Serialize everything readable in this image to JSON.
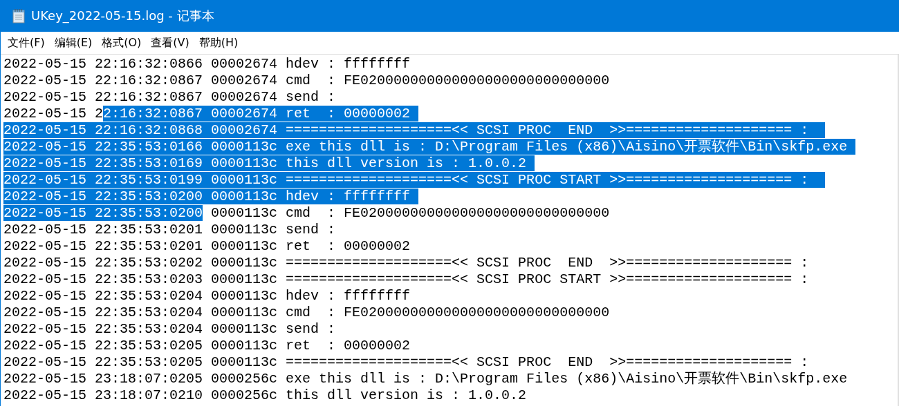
{
  "window": {
    "title": "UKey_2022-05-15.log - 记事本"
  },
  "menu": [
    {
      "label": "文件(F)"
    },
    {
      "label": "编辑(E)"
    },
    {
      "label": "格式(O)"
    },
    {
      "label": "查看(V)"
    },
    {
      "label": "帮助(H)"
    }
  ],
  "lines": [
    {
      "segments": [
        {
          "text": "2022-05-15 22:16:32:0866 00002674 hdev : ffffffff",
          "selected": false
        }
      ]
    },
    {
      "segments": [
        {
          "text": "2022-05-15 22:16:32:0867 00002674 cmd  : FE020000000000000000000000000000",
          "selected": false
        }
      ]
    },
    {
      "segments": [
        {
          "text": "2022-05-15 22:16:32:0867 00002674 send :",
          "selected": false
        }
      ]
    },
    {
      "segments": [
        {
          "text": "2022-05-15 2",
          "selected": false
        },
        {
          "text": "2:16:32:0867 00002674 ret  : 00000002",
          "selected": true
        }
      ]
    },
    {
      "segments": [
        {
          "text": "2022-05-15 22:16:32:0868 00002674 ====================<< SCSI PROC  END  >>==================== : ",
          "selected": true
        }
      ]
    },
    {
      "segments": [
        {
          "text": "2022-05-15 22:35:53:0166 0000113c exe this dll is : D:\\Program Files (x86)\\Aisino\\开票软件\\Bin\\skfp.exe",
          "selected": true
        }
      ]
    },
    {
      "segments": [
        {
          "text": "2022-05-15 22:35:53:0169 0000113c this dll version is : 1.0.0.2",
          "selected": true
        }
      ]
    },
    {
      "segments": [
        {
          "text": "2022-05-15 22:35:53:0199 0000113c ====================<< SCSI PROC START >>==================== : ",
          "selected": true
        }
      ]
    },
    {
      "segments": [
        {
          "text": "2022-05-15 22:35:53:0200 0000113c hdev : ffffffff",
          "selected": true
        }
      ]
    },
    {
      "segments": [
        {
          "text": "2022-05-15 22:35:53:0200",
          "selected": true
        },
        {
          "text": " 0000113c cmd  : FE020000000000000000000000000000",
          "selected": false
        }
      ]
    },
    {
      "segments": [
        {
          "text": "2022-05-15 22:35:53:0201 0000113c send :",
          "selected": false
        }
      ]
    },
    {
      "segments": [
        {
          "text": "2022-05-15 22:35:53:0201 0000113c ret  : 00000002",
          "selected": false
        }
      ]
    },
    {
      "segments": [
        {
          "text": "2022-05-15 22:35:53:0202 0000113c ====================<< SCSI PROC  END  >>==================== :",
          "selected": false
        }
      ]
    },
    {
      "segments": [
        {
          "text": "2022-05-15 22:35:53:0203 0000113c ====================<< SCSI PROC START >>==================== :",
          "selected": false
        }
      ]
    },
    {
      "segments": [
        {
          "text": "2022-05-15 22:35:53:0204 0000113c hdev : ffffffff",
          "selected": false
        }
      ]
    },
    {
      "segments": [
        {
          "text": "2022-05-15 22:35:53:0204 0000113c cmd  : FE020000000000000000000000000000",
          "selected": false
        }
      ]
    },
    {
      "segments": [
        {
          "text": "2022-05-15 22:35:53:0204 0000113c send :",
          "selected": false
        }
      ]
    },
    {
      "segments": [
        {
          "text": "2022-05-15 22:35:53:0205 0000113c ret  : 00000002",
          "selected": false
        }
      ]
    },
    {
      "segments": [
        {
          "text": "2022-05-15 22:35:53:0205 0000113c ====================<< SCSI PROC  END  >>==================== :",
          "selected": false
        }
      ]
    },
    {
      "segments": [
        {
          "text": "2022-05-15 23:18:07:0205 0000256c exe this dll is : D:\\Program Files (x86)\\Aisino\\开票软件\\Bin\\skfp.exe",
          "selected": false
        }
      ]
    },
    {
      "segments": [
        {
          "text": "2022-05-15 23:18:07:0210 0000256c this dll version is : 1.0.0.2",
          "selected": false
        }
      ]
    }
  ]
}
